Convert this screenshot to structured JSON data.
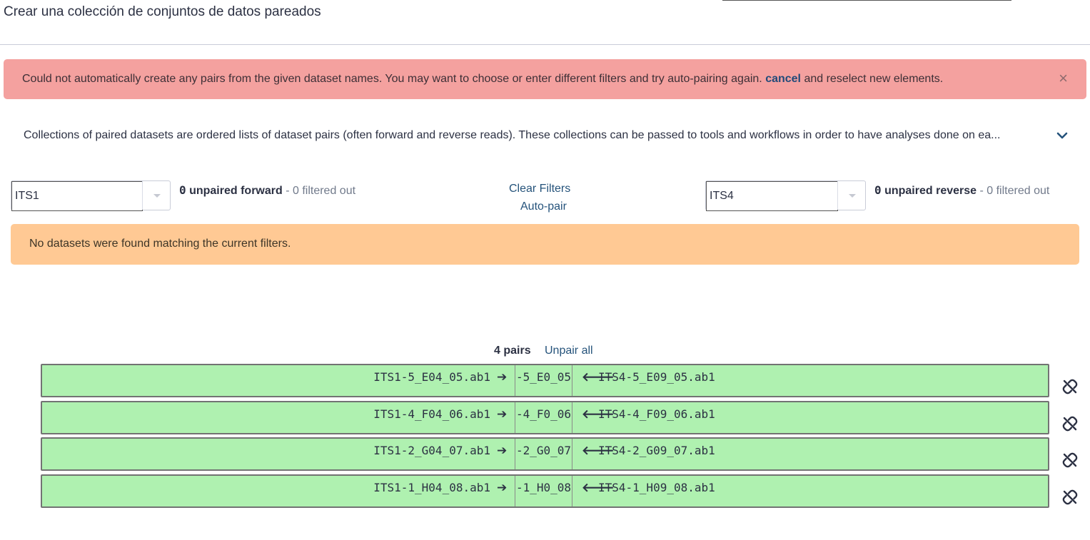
{
  "header": {
    "title": "Crear una colección de conjuntos de datos pareados"
  },
  "alert_danger": {
    "message_before": "Could not automatically create any pairs from the given dataset names. You may want to choose or enter different filters and try auto-pairing again. ",
    "cancel_link": "cancel",
    "message_after": " and reselect new elements.",
    "close_label": "×"
  },
  "help": {
    "text": "Collections of paired datasets are ordered lists of dataset pairs (often forward and reverse reads). These collections can be passed to tools and workflows in order to have analyses done on ea...",
    "expand_icon": "chevron-down-icon"
  },
  "forward": {
    "filter_value": "ITS1",
    "count": "0",
    "count_label": " unpaired forward",
    "filtered_text": " - 0 filtered out"
  },
  "reverse": {
    "filter_value": "ITS4",
    "count": "0",
    "count_label": " unpaired reverse",
    "filtered_text": " - 0 filtered out"
  },
  "actions": {
    "clear_filters": "Clear Filters",
    "auto_pair": "Auto-pair"
  },
  "alert_warning": {
    "message": "No datasets were found matching the current filters."
  },
  "pairs": {
    "count_label": "4 pairs",
    "unpair_all": "Unpair all",
    "right_arrow": "➔",
    "left_arrow": "🡐",
    "rows": [
      {
        "forward": "ITS1-5_E04_05.ab1",
        "name": "-5_E0_05",
        "reverse": "ITS4-5_E09_05.ab1"
      },
      {
        "forward": "ITS1-4_F04_06.ab1",
        "name": "-4_F0_06",
        "reverse": "ITS4-4_F09_06.ab1"
      },
      {
        "forward": "ITS1-2_G04_07.ab1",
        "name": "-2_G0_07",
        "reverse": "ITS4-2_G09_07.ab1"
      },
      {
        "forward": "ITS1-1_H04_08.ab1",
        "name": "-1_H0_08",
        "reverse": "ITS4-1_H09_08.ab1"
      }
    ]
  },
  "colors": {
    "danger_bg": "#f4a19f",
    "warning_bg": "#ffc994",
    "pair_bg": "#aff1b0",
    "link": "#25537b"
  }
}
